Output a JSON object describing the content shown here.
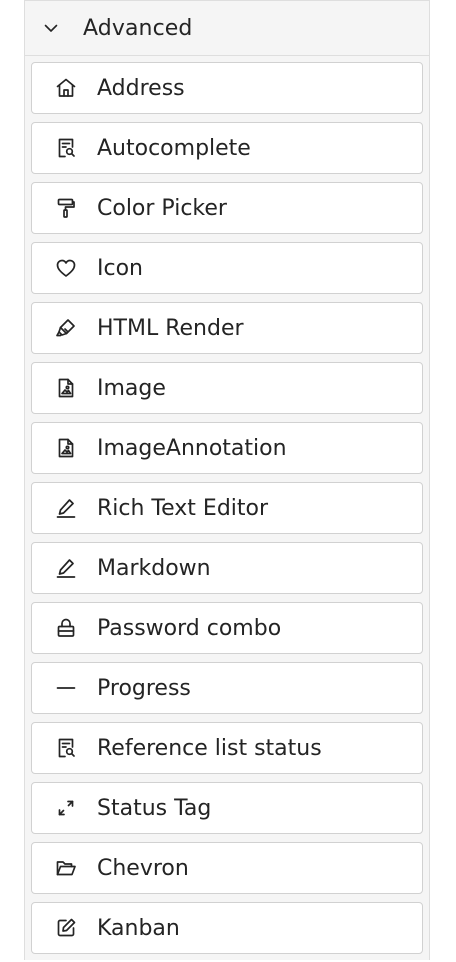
{
  "section": {
    "title": "Advanced",
    "icon": "chevron-down-icon"
  },
  "items": [
    {
      "label": "Address",
      "icon": "home-icon"
    },
    {
      "label": "Autocomplete",
      "icon": "document-search-icon"
    },
    {
      "label": "Color Picker",
      "icon": "paint-roller-icon"
    },
    {
      "label": "Icon",
      "icon": "heart-icon"
    },
    {
      "label": "HTML Render",
      "icon": "highlighter-icon"
    },
    {
      "label": "Image",
      "icon": "image-document-icon"
    },
    {
      "label": "ImageAnnotation",
      "icon": "image-document-icon"
    },
    {
      "label": "Rich Text Editor",
      "icon": "pen-underline-icon"
    },
    {
      "label": "Markdown",
      "icon": "pen-underline-icon"
    },
    {
      "label": "Password combo",
      "icon": "lock-icon"
    },
    {
      "label": "Progress",
      "icon": "line-icon"
    },
    {
      "label": "Reference list status",
      "icon": "document-search-icon"
    },
    {
      "label": "Status Tag",
      "icon": "expand-arrows-icon"
    },
    {
      "label": "Chevron",
      "icon": "folder-open-icon"
    },
    {
      "label": "Kanban",
      "icon": "edit-square-icon"
    }
  ]
}
